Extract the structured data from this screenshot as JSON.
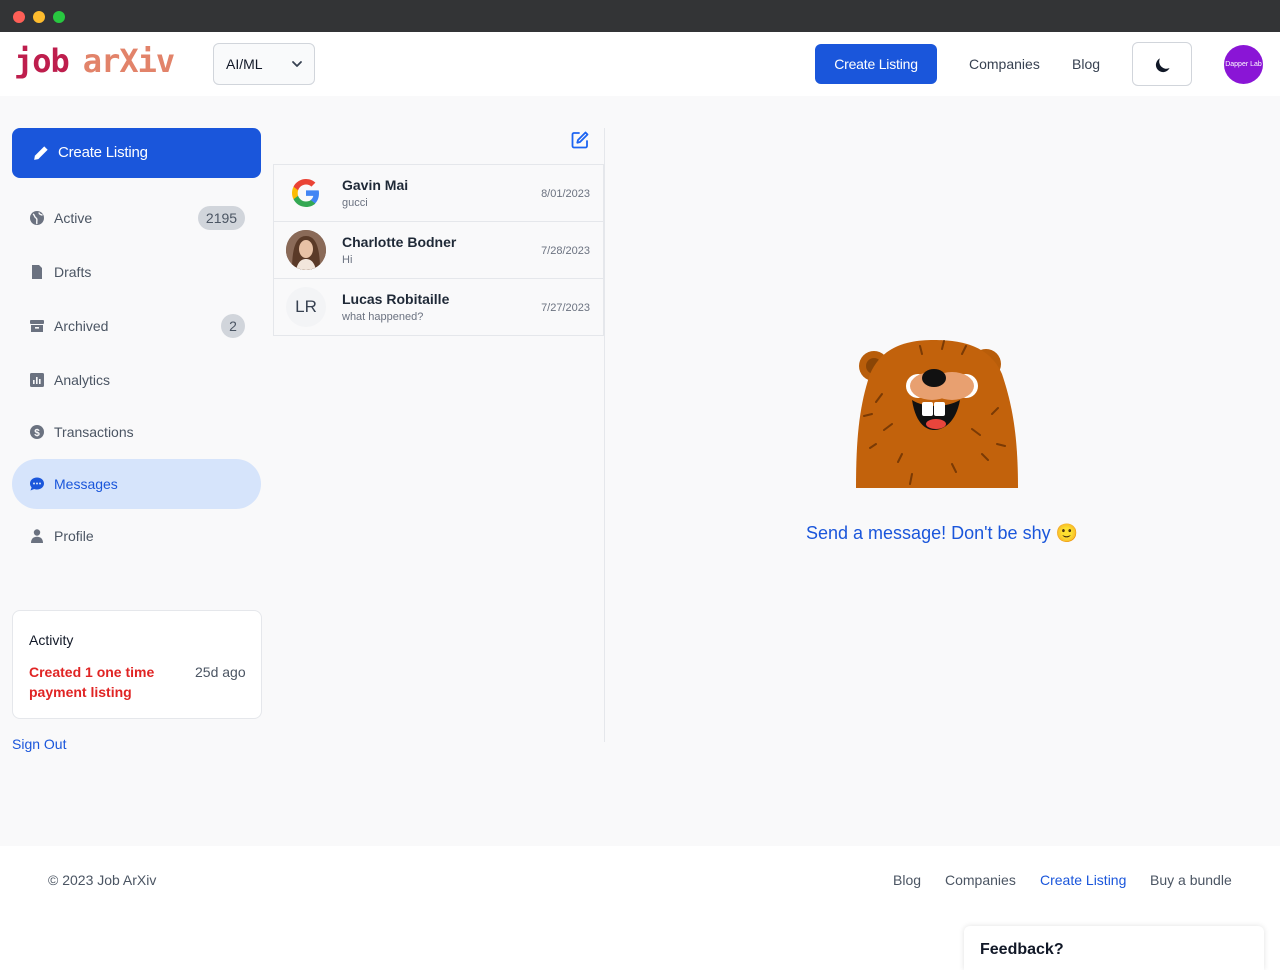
{
  "header": {
    "logo_part1": "job",
    "logo_part2": "arXiv",
    "category_select": "AI/ML",
    "create_listing": "Create Listing",
    "companies": "Companies",
    "blog": "Blog",
    "avatar_text": "Dapper Lab"
  },
  "sidebar": {
    "create_listing": "Create Listing",
    "items": [
      {
        "label": "Active",
        "badge": "2195"
      },
      {
        "label": "Drafts"
      },
      {
        "label": "Archived",
        "badge": "2"
      },
      {
        "label": "Analytics"
      },
      {
        "label": "Transactions"
      },
      {
        "label": "Messages"
      },
      {
        "label": "Profile"
      }
    ],
    "activity": {
      "title": "Activity",
      "message": "Created 1 one time payment listing",
      "time": "25d ago"
    },
    "sign_out": "Sign Out"
  },
  "messages": [
    {
      "name": "Gavin Mai",
      "preview": "gucci",
      "date": "8/01/2023"
    },
    {
      "name": "Charlotte Bodner",
      "preview": "Hi",
      "date": "7/28/2023"
    },
    {
      "name": "Lucas Robitaille",
      "preview": "what happened?",
      "date": "7/27/2023",
      "initials": "LR"
    }
  ],
  "empty_state": {
    "text": "Send a message! Don't be shy 🙂"
  },
  "footer": {
    "copyright": "© 2023 Job ArXiv",
    "links": [
      "Blog",
      "Companies",
      "Create Listing",
      "Buy a bundle"
    ]
  },
  "feedback": "Feedback?",
  "colors": {
    "primary": "#1a56db",
    "logo_red": "#be1e4d",
    "logo_orange": "#e2836a",
    "activity_red": "#e02424"
  }
}
